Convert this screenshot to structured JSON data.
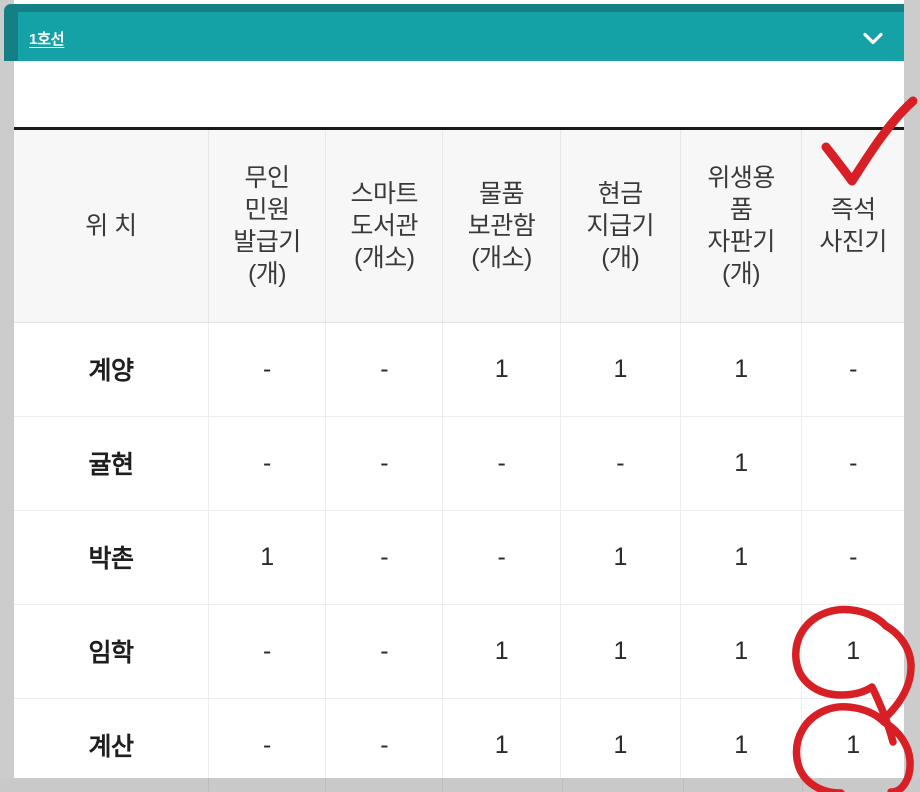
{
  "accordion": {
    "title": "1호선",
    "chevron_icon": "chevron-down-icon",
    "expanded": true,
    "bar_color": "#14a2a6",
    "title_color": "#ffffff"
  },
  "table": {
    "columns": [
      "위 치",
      "무인\n민원\n발급기\n(개)",
      "스마트\n도서관\n(개소)",
      "물품\n보관함\n(개소)",
      "현금\n지급기\n(개)",
      "위생용\n품\n자판기\n(개)",
      "즉석\n사진기"
    ],
    "rows": [
      {
        "location": "계양",
        "values": [
          "-",
          "-",
          "1",
          "1",
          "1",
          "-"
        ]
      },
      {
        "location": "귤현",
        "values": [
          "-",
          "-",
          "-",
          "-",
          "1",
          "-"
        ]
      },
      {
        "location": "박촌",
        "values": [
          "1",
          "-",
          "-",
          "1",
          "1",
          "-"
        ]
      },
      {
        "location": "임학",
        "values": [
          "-",
          "-",
          "1",
          "1",
          "1",
          "1"
        ]
      },
      {
        "location": "계산",
        "values": [
          "-",
          "-",
          "1",
          "1",
          "1",
          "1"
        ]
      }
    ]
  },
  "annotations": {
    "ink_color": "#d81f26",
    "checkmark": {
      "name": "red-checkmark-annotation",
      "target_column": "즉석 사진기"
    },
    "circles": [
      {
        "name": "red-circle-annotation",
        "target_row": "임학",
        "target_column": "즉석 사진기",
        "target_value": "1"
      },
      {
        "name": "red-circle-annotation",
        "target_row": "계산",
        "target_column": "즉석 사진기",
        "target_value": "1"
      }
    ]
  }
}
